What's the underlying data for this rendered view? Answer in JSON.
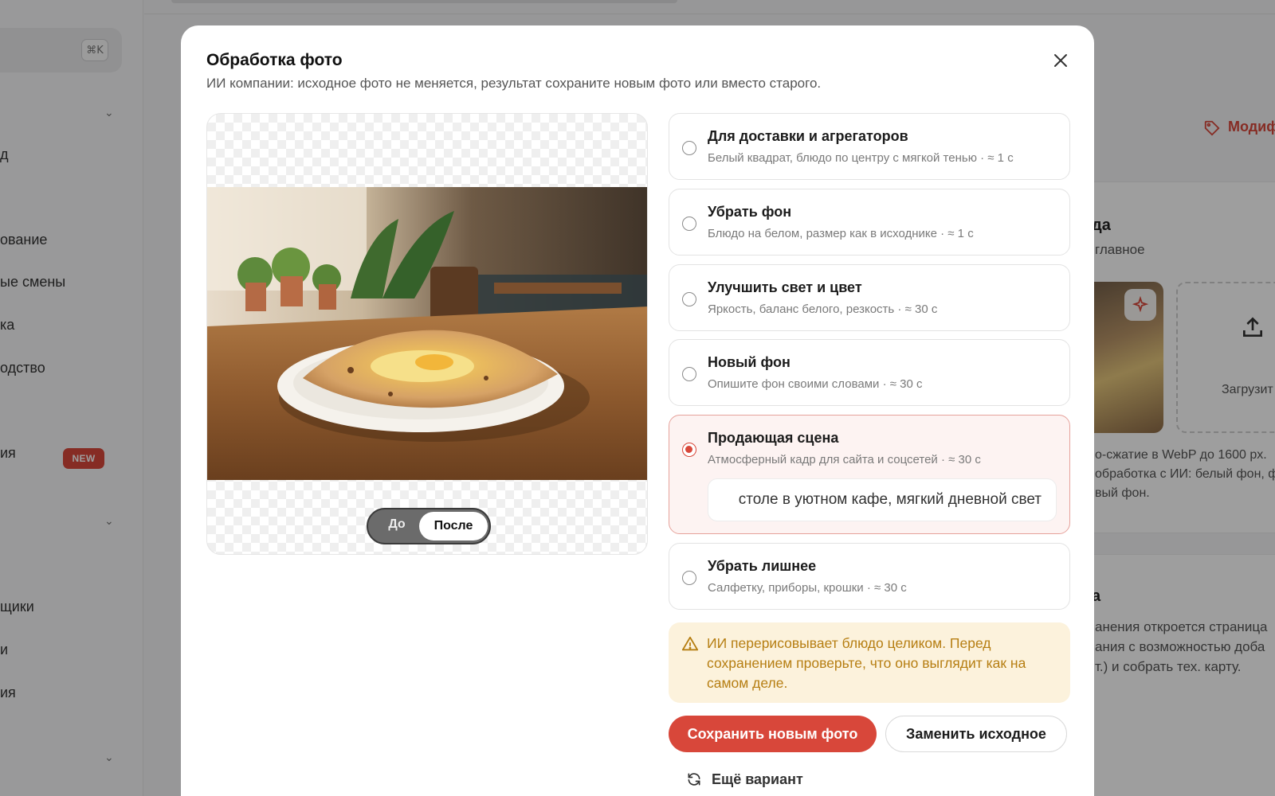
{
  "background": {
    "search_shortcut": "⌘K",
    "nav_items": [
      "д",
      "ование",
      "ые смены",
      "ка",
      "одство",
      "ия",
      "щики",
      "и",
      "ия"
    ],
    "new_badge": "NEW",
    "modifier_link": "Модиф",
    "section_title": "да",
    "section_sub": "главное",
    "upload_label": "Загрузит",
    "note_lines": [
      "о-сжатие в WebP до 1600 px. ",
      "обработка с ИИ: белый фон, ф",
      "вый фон."
    ],
    "section2_title": "а",
    "section2_lines": [
      "анения откроется страница",
      "ания с возможностью доба",
      "т.) и собрать тех. карту."
    ]
  },
  "modal": {
    "title": "Обработка фото",
    "subtitle": "ИИ компании: исходное фото не меняется, результат сохраните новым фото или вместо старого.",
    "toggle": {
      "before": "До",
      "after": "После",
      "active": "after"
    },
    "options": [
      {
        "title": "Для доставки и агрегаторов",
        "desc": "Белый квадрат, блюдо по центру с мягкой тенью · ≈ 1 с",
        "selected": false
      },
      {
        "title": "Убрать фон",
        "desc": "Блюдо на белом, размер как в исходнике · ≈ 1 с",
        "selected": false
      },
      {
        "title": "Улучшить свет и цвет",
        "desc": "Яркость, баланс белого, резкость · ≈ 30 с",
        "selected": false
      },
      {
        "title": "Новый фон",
        "desc": "Опишите фон своими словами · ≈ 30 с",
        "selected": false
      },
      {
        "title": "Продающая сцена",
        "desc": "Атмосферный кадр для сайта и соцсетей · ≈ 30 с",
        "selected": true
      },
      {
        "title": "Убрать лишнее",
        "desc": "Салфетку, приборы, крошки · ≈ 30 с",
        "selected": false
      }
    ],
    "scene_input_value": "столе в уютном кафе, мягкий дневной свет",
    "warning": "ИИ перерисовывает блюдо целиком. Перед сохранением проверьте, что оно выглядит как на самом деле.",
    "save_new_label": "Сохранить новым фото",
    "replace_label": "Заменить исходное",
    "another_label": "Ещё вариант"
  },
  "colors": {
    "accent": "#d8473a",
    "warning_bg": "#fcf2dc",
    "warning_text": "#b67e12"
  }
}
